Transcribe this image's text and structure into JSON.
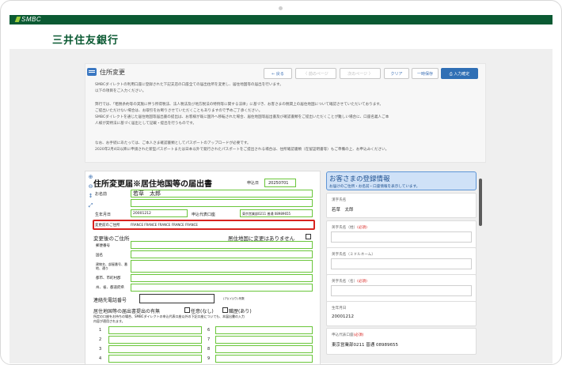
{
  "brand": {
    "logo": "SMBC",
    "bank_name": "三井住友銀行"
  },
  "panel": {
    "title": "住所変更",
    "buttons": {
      "back": "← 戻る",
      "prev_page": "〈 前のページ",
      "next_page": "次のページ 〉",
      "clear": "クリア",
      "temp_save": "一時保存",
      "confirm": "入力確定"
    },
    "notices": [
      "SMBCダイレクトの利用口座に登録された下記支店の口座全ての届出住所を変更し、居住地国等の届出を行います。",
      "以下の項目をご入力ください。",
      "",
      "弊行では、「租税条約等の実施に伴う所得税法、法人税法及び地方税法の特例等に関する法律」に基づき、お客さまの税関上の居住地国について確認させていただいております。",
      "ご提出いただけない場合は、お取引をお断りさせていただくこともありますので予めご了承ください。",
      "SMBCダイレクトを通じた居住地国等届出書の提出は、お客様が既に国外へ移転された場合、居住地国等届出書及び確認書類をご提出いただくことが難しい場合に、口座名義人ご本",
      "人様が実特法に基づく届出として記載・提出を行うものです。",
      "",
      "なお、お手続にあたっては、ご本人さま確認書類としてパスポートのアップロードが必要です。",
      "2020年2月4日以降に申請された新型パスポートまたは日本以外で発行されたパスポートをご提出される場合は、住所確認書類（在留証明書等）もご準備の上、お申込みください。"
    ]
  },
  "form": {
    "title": "住所変更届※居住地国等の届出書",
    "apply_date_label": "申込日",
    "apply_date": "20250701",
    "name_label": "お名前",
    "name_value": "若草　太郎",
    "birth_label": "生年月日",
    "birth_value": "20001212",
    "account_label": "申込代表口座",
    "account_value": "東京営業部0211 普通 08989655",
    "new_address_label": "変更前のご住所",
    "new_address_value": "FRANCE FRANCE FRANCE FRANCE FRANCE",
    "after_address_label": "変更後のご住所",
    "no_change_note": "居住地国に変更はありません",
    "postal_label": "郵便番号",
    "country_label": "国名",
    "pref_label": "建物名、部屋番号、番地、通り",
    "city_label": "都市、市町村郡",
    "state_label": "州、省、都道府県",
    "tel_label": "連絡先電話番号",
    "tel_note": "(ア)(イ)(ウ) 桁数",
    "residence_title": "居住地国等の届出書提出の有無",
    "option_none": "任意(なし)",
    "option_yes": "職歴(あり)",
    "residence_note": "所定の口座をお持ちの場合、SMBCダイレクトの申込代表口座以外の下記口座についても、本届出書の入力",
    "residence_note2": "内容が適用されます。",
    "rows_left": [
      "1",
      "2",
      "3",
      "4"
    ],
    "rows_right": [
      "6",
      "7",
      "8",
      "9"
    ]
  },
  "registered": {
    "title": "お客さまの登録情報",
    "subtitle": "お届けのご住所・お名前・口座情報を表示しています。",
    "cards": [
      {
        "label": "漢字氏名",
        "value": "若草　太郎",
        "required": ""
      },
      {
        "label": "英字氏名（姓）",
        "value": "",
        "required": "(必須)"
      },
      {
        "label": "英字氏名（ミドルネーム）",
        "value": "",
        "required": ""
      },
      {
        "label": "英字氏名（名）",
        "value": "",
        "required": "(必須)"
      },
      {
        "label": "生年月日",
        "value": "20001212",
        "required": ""
      },
      {
        "label": "申込代表口座",
        "value": "東京営業部0211 普通 08989655",
        "required": "(必須)"
      }
    ]
  }
}
